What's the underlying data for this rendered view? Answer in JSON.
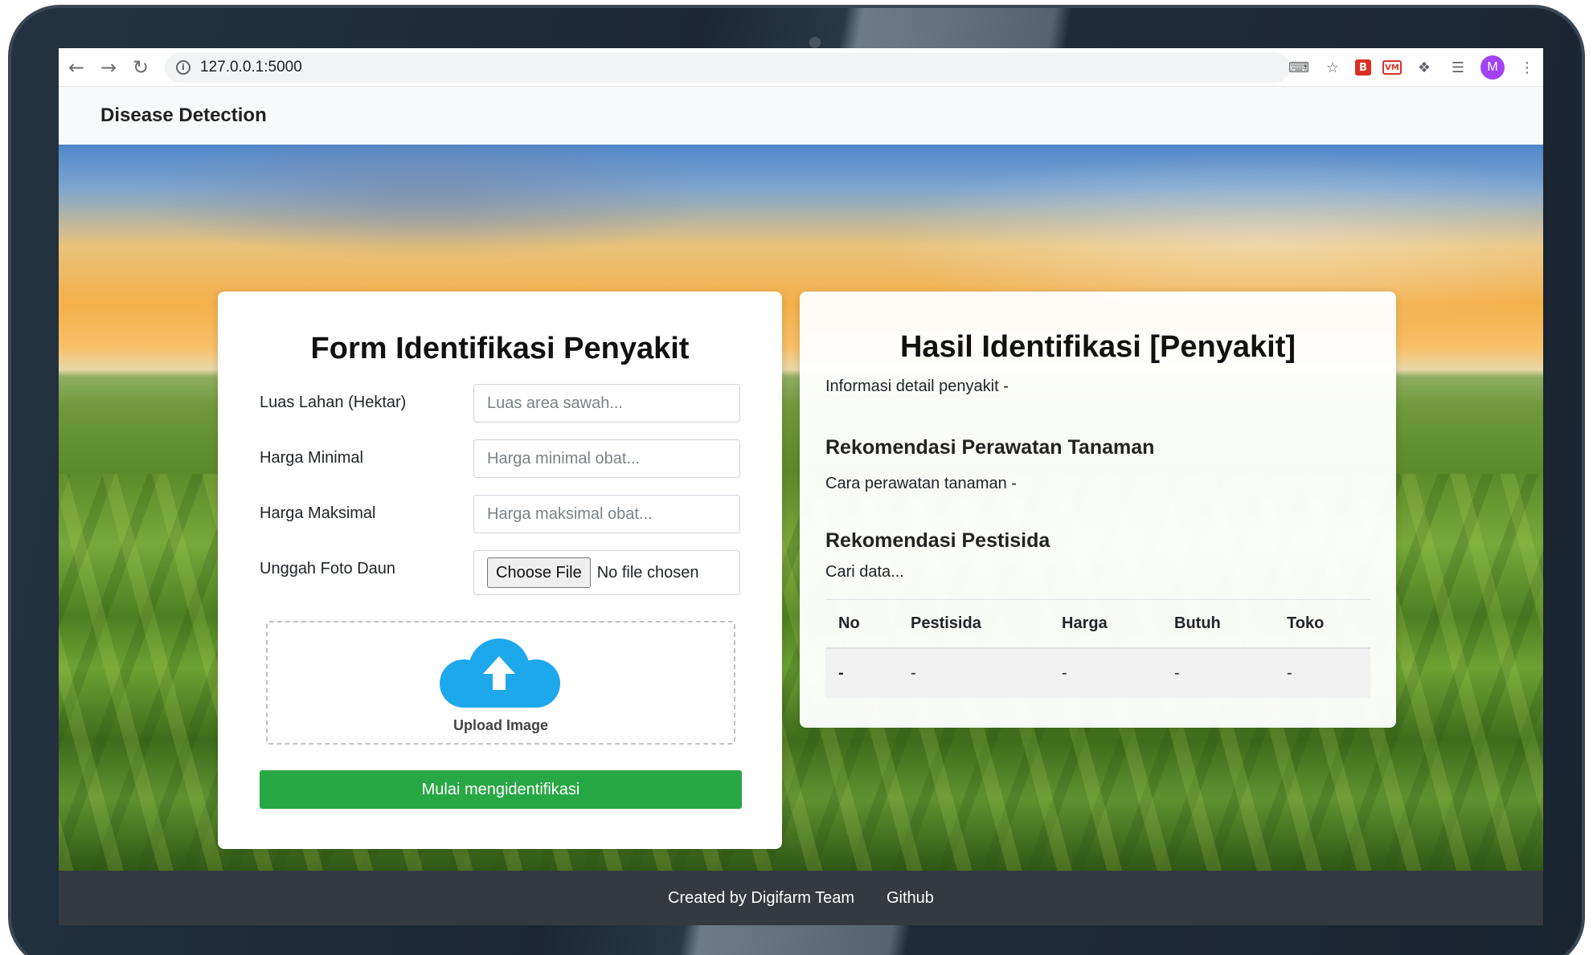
{
  "browser": {
    "url": "127.0.0.1:5000",
    "avatar_initial": "M",
    "ext_b_label": "B",
    "ext_vm_label": "VM"
  },
  "navbar": {
    "brand": "Disease Detection"
  },
  "form": {
    "title": "Form Identifikasi Penyakit",
    "fields": [
      {
        "label": "Luas Lahan (Hektar)",
        "placeholder": "Luas area sawah..."
      },
      {
        "label": "Harga Minimal",
        "placeholder": "Harga minimal obat..."
      },
      {
        "label": "Harga Maksimal",
        "placeholder": "Harga maksimal obat..."
      }
    ],
    "upload_label": "Unggah Foto Daun",
    "file_button": "Choose File",
    "file_status": "No file chosen",
    "dropzone_label": "Upload Image",
    "submit_label": "Mulai mengidentifikasi"
  },
  "result": {
    "title": "Hasil Identifikasi [Penyakit]",
    "detail_info": "Informasi detail penyakit -",
    "care_heading": "Rekomendasi Perawatan Tanaman",
    "care_text": "Cara perawatan tanaman -",
    "pesticide_heading": "Rekomendasi Pestisida",
    "pesticide_search": "Cari data...",
    "table": {
      "columns": [
        "No",
        "Pestisida",
        "Harga",
        "Butuh",
        "Toko"
      ],
      "rows": [
        [
          "-",
          "-",
          "-",
          "-",
          "-"
        ]
      ]
    }
  },
  "footer": {
    "credit": "Created by Digifarm Team",
    "link": "Github"
  },
  "colors": {
    "primary_green": "#28a745",
    "footer_bg": "#343a40",
    "cloud_blue": "#1ea8ec"
  }
}
